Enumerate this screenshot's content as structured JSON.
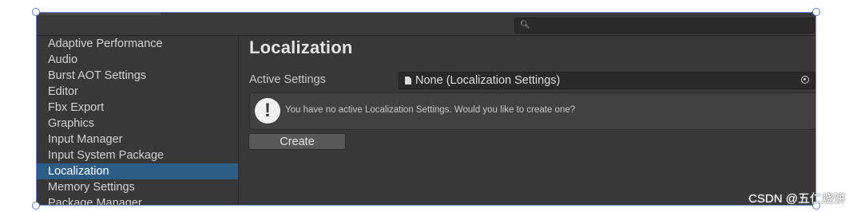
{
  "topbar": {
    "search": {
      "placeholder": "",
      "icon": "search-icon"
    }
  },
  "sidebar": {
    "items": [
      {
        "label": "Adaptive Performance",
        "active": false
      },
      {
        "label": "Audio",
        "active": false
      },
      {
        "label": "Burst AOT Settings",
        "active": false
      },
      {
        "label": "Editor",
        "active": false
      },
      {
        "label": "Fbx Export",
        "active": false
      },
      {
        "label": "Graphics",
        "active": false
      },
      {
        "label": "Input Manager",
        "active": false
      },
      {
        "label": "Input System Package",
        "active": false
      },
      {
        "label": "Localization",
        "active": true
      },
      {
        "label": "Memory Settings",
        "active": false
      },
      {
        "label": "Package Manager",
        "active": false
      }
    ],
    "active_color": "#2c5d87"
  },
  "main": {
    "title": "Localization",
    "active_settings": {
      "label": "Active Settings",
      "value": "None (Localization Settings)",
      "icon": "document-icon",
      "picker_icon": "object-picker-icon"
    },
    "help": {
      "icon": "info-exclamation-icon",
      "glyph": "!",
      "text": "You have no active Localization Settings. Would you like to create one?"
    },
    "create_label": "Create"
  },
  "watermark": "CSDN @五仁烧饼"
}
